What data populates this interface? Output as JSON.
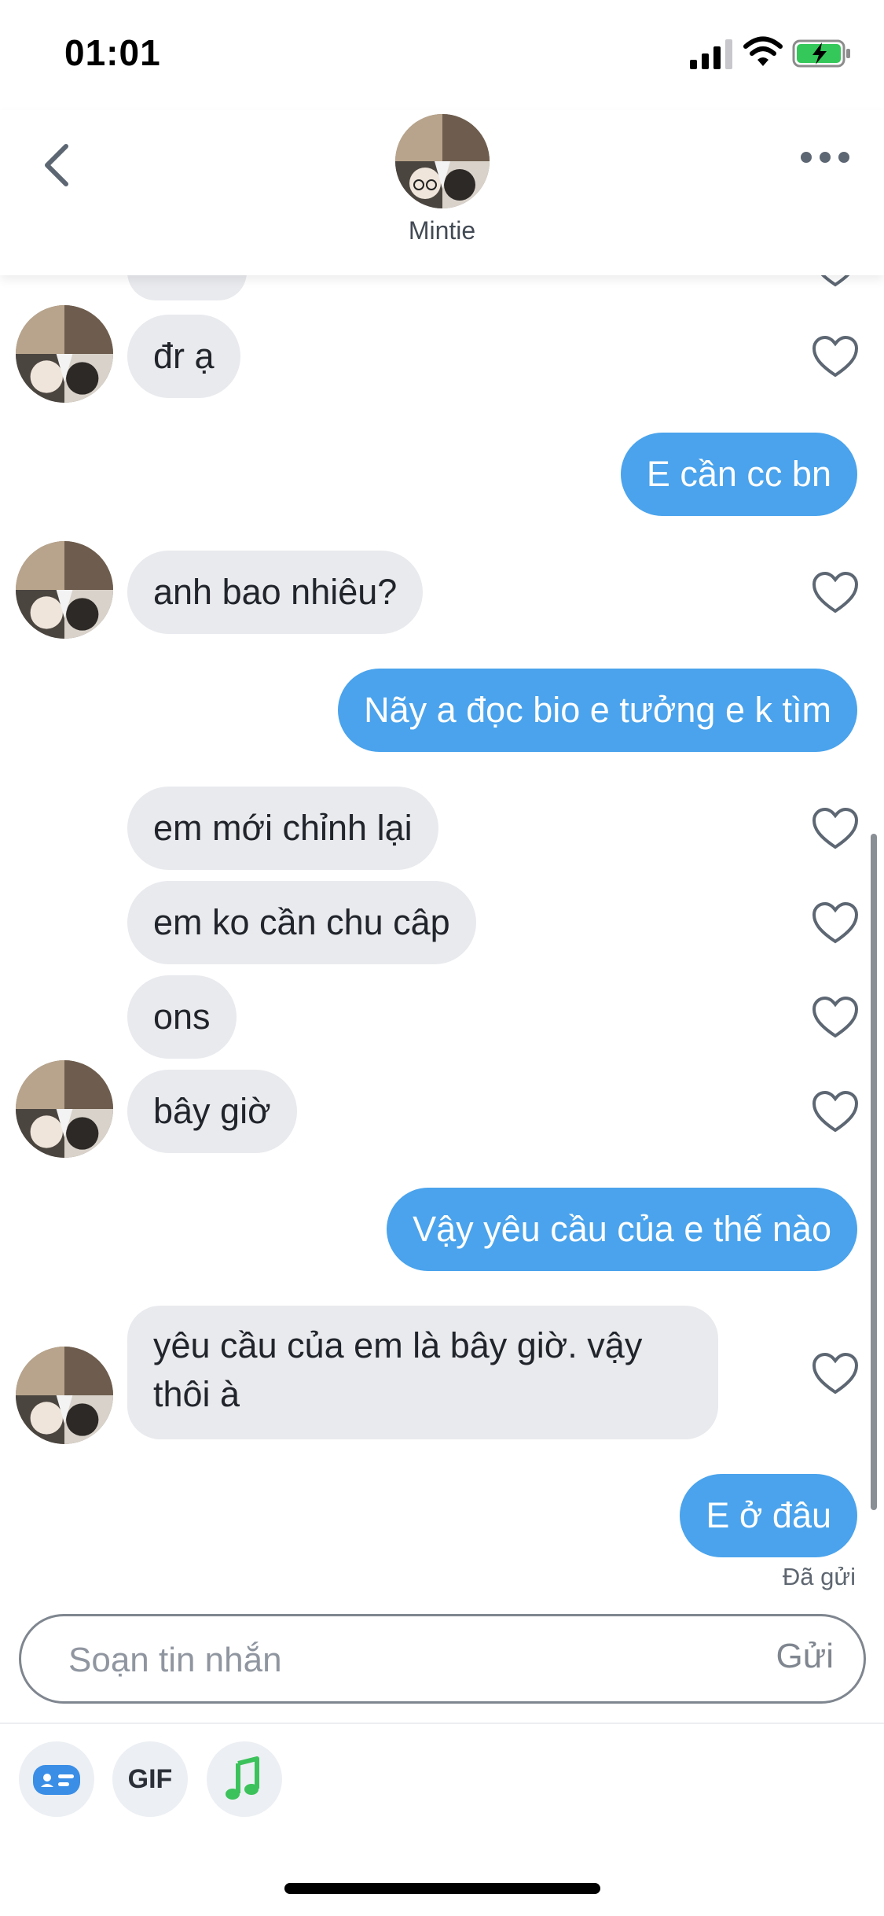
{
  "status_bar": {
    "time": "01:01"
  },
  "header": {
    "contact_name": "Mintie"
  },
  "messages": [
    {
      "id": 0,
      "side": "received",
      "text": "đr ạ"
    },
    {
      "id": 1,
      "side": "sent",
      "text": "E cần cc bn"
    },
    {
      "id": 2,
      "side": "received",
      "text": "anh bao nhiêu?"
    },
    {
      "id": 3,
      "side": "sent",
      "text": "Nãy a đọc bio e tưởng e k tìm"
    },
    {
      "id": 4,
      "side": "received",
      "text": "em mới chỉnh lại"
    },
    {
      "id": 5,
      "side": "received",
      "text": "em ko cần chu câp"
    },
    {
      "id": 6,
      "side": "received",
      "text": "ons"
    },
    {
      "id": 7,
      "side": "received",
      "text": "bây giờ"
    },
    {
      "id": 8,
      "side": "sent",
      "text": "Vậy yêu cầu của e thế nào"
    },
    {
      "id": 9,
      "side": "received",
      "text": "yêu cầu của em là bây giờ. vậy thôi à"
    },
    {
      "id": 10,
      "side": "sent",
      "text": "E ở đâu"
    }
  ],
  "sent_status": "Đã gửi",
  "compose": {
    "placeholder": "Soạn tin nhắn",
    "send_label": "Gửi"
  },
  "toolbar": {
    "gif_label": "GIF",
    "icons": [
      "contact-card-icon",
      "gif-icon",
      "music-note-icon"
    ]
  },
  "colors": {
    "sent_bubble": "#4aa3ec",
    "received_bubble": "#e9eaee",
    "music_icon": "#3cc25b",
    "card_icon": "#3a8ee6",
    "battery_charging": "#34c759"
  }
}
